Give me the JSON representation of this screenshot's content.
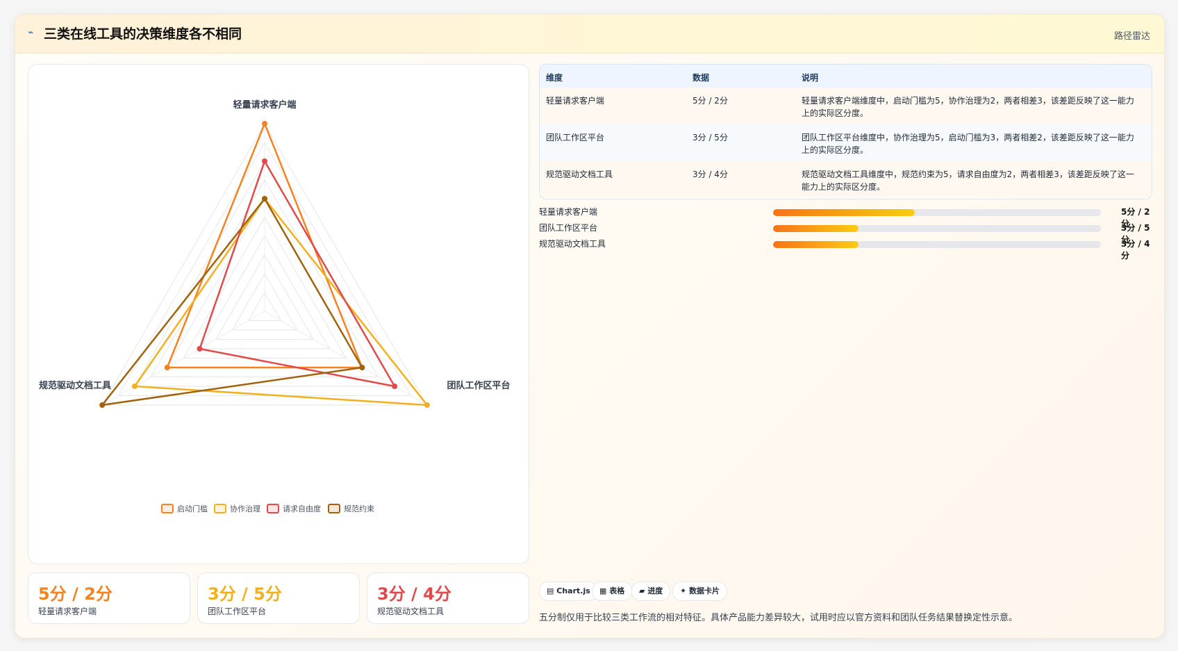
{
  "header": {
    "icon": "squiggle-icon",
    "title": "三类在线工具的决策维度各不相同",
    "tag": "路径雷达"
  },
  "chart_data": {
    "type": "radar",
    "axes": [
      "轻量请求客户端",
      "团队工作区平台",
      "规范驱动文档工具"
    ],
    "max": 5,
    "grid_levels": 10,
    "series": [
      {
        "name": "启动门槛",
        "color": "#f58220",
        "values": [
          5,
          3,
          3
        ]
      },
      {
        "name": "协作治理",
        "color": "#f2b01e",
        "values": [
          3,
          5,
          4
        ]
      },
      {
        "name": "请求自由度",
        "color": "#e04a4a",
        "values": [
          4,
          4,
          2
        ]
      },
      {
        "name": "规范约束",
        "color": "#a0620a",
        "values": [
          3,
          3,
          5
        ]
      }
    ],
    "legend_position": "bottom"
  },
  "stats": [
    {
      "value": "5分 / 2分",
      "label": "轻量请求客户端",
      "color": "#f58220"
    },
    {
      "value": "3分 / 5分",
      "label": "团队工作区平台",
      "color": "#f2b01e"
    },
    {
      "value": "3分 / 4分",
      "label": "规范驱动文档工具",
      "color": "#e04a4a"
    }
  ],
  "table": {
    "headers": [
      "维度",
      "数据",
      "说明"
    ],
    "rows": [
      {
        "dim": "轻量请求客户端",
        "data": "5分 / 2分",
        "desc": "轻量请求客户端维度中，启动门槛为5，协作治理为2，两者相差3，该差距反映了这一能力上的实际区分度。"
      },
      {
        "dim": "团队工作区平台",
        "data": "3分 / 5分",
        "desc": "团队工作区平台维度中，协作治理为5，启动门槛为3，两者相差2，该差距反映了这一能力上的实际区分度。"
      },
      {
        "dim": "规范驱动文档工具",
        "data": "3分 / 4分",
        "desc": "规范驱动文档工具维度中，规范约束为5，请求自由度为2，两者相差3，该差距反映了这一能力上的实际区分度。"
      }
    ]
  },
  "progress": [
    {
      "label": "轻量请求客户端",
      "value": "5分 / 2分",
      "fraction": 0.433
    },
    {
      "label": "团队工作区平台",
      "value": "3分 / 5分",
      "fraction": 0.26
    },
    {
      "label": "规范驱动文档工具",
      "value": "3分 / 4分",
      "fraction": 0.26
    }
  ],
  "chips": [
    {
      "icon": "chart-icon",
      "glyph": "▤",
      "label": "Chart.js"
    },
    {
      "icon": "table-icon",
      "glyph": "▦",
      "label": "表格"
    },
    {
      "icon": "progress-icon",
      "glyph": "▰",
      "label": "进度"
    },
    {
      "icon": "sparkle-icon",
      "glyph": "✦",
      "label": "数据卡片"
    }
  ],
  "footnote": "五分制仅用于比较三类工作流的相对特征。具体产品能力差异较大，试用时应以官方资料和团队任务结果替换定性示意。"
}
